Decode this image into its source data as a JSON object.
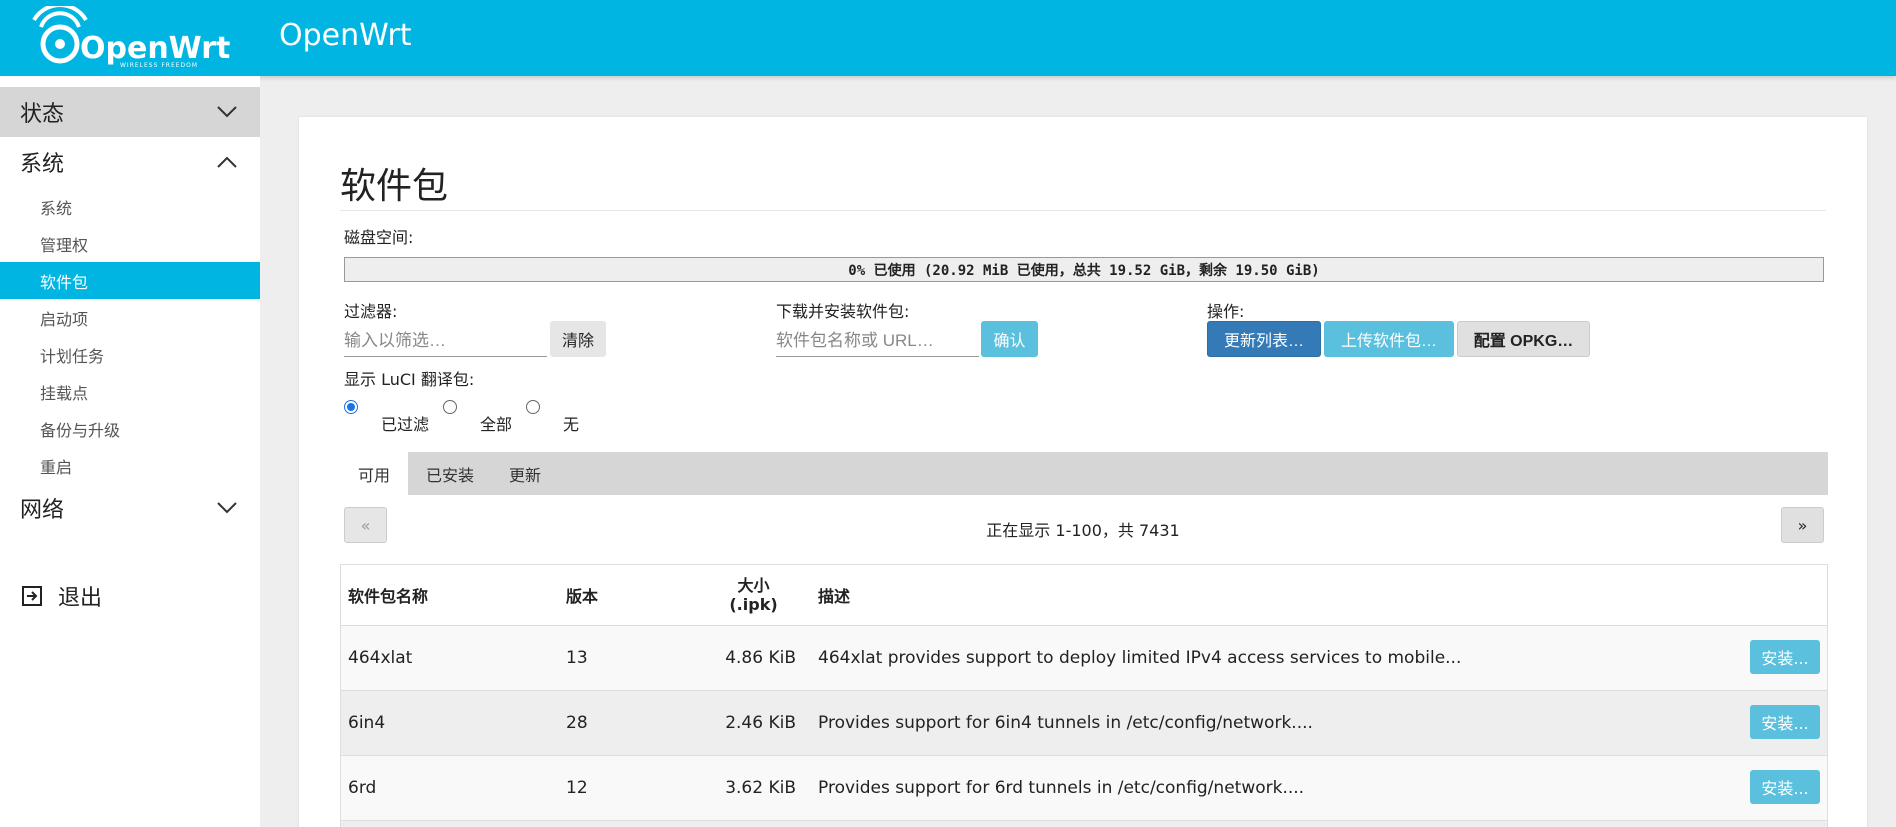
{
  "header": {
    "logo_text": "OpenWrt",
    "logo_tagline": "WIRELESS FREEDOM",
    "hostname": "OpenWrt"
  },
  "sidebar": {
    "sections": [
      {
        "label": "状态",
        "expanded": false
      },
      {
        "label": "系统",
        "expanded": true
      },
      {
        "label": "网络",
        "expanded": false
      }
    ],
    "system_items": [
      {
        "label": "系统"
      },
      {
        "label": "管理权"
      },
      {
        "label": "软件包",
        "selected": true
      },
      {
        "label": "启动项"
      },
      {
        "label": "计划任务"
      },
      {
        "label": "挂载点"
      },
      {
        "label": "备份与升级"
      },
      {
        "label": "重启"
      }
    ],
    "logout_label": "退出"
  },
  "page": {
    "title": "软件包",
    "disk_label": "磁盘空间:",
    "disk_usage_text": "0% 已使用 (20.92 MiB 已使用，总共 19.52 GiB，剩余 19.50 GiB)",
    "disk_usage_percent": 0,
    "filter": {
      "label": "过滤器:",
      "placeholder": "输入以筛选…",
      "clear_button": "清除"
    },
    "download": {
      "label": "下载并安装软件包:",
      "placeholder": "软件包名称或 URL…",
      "confirm_button": "确认"
    },
    "actions": {
      "label": "操作:",
      "update_button": "更新列表…",
      "upload_button": "上传软件包…",
      "configure_button": "配置 OPKG…"
    },
    "luci_translations": {
      "label": "显示 LuCI 翻译包:",
      "options": [
        "已过滤",
        "全部",
        "无"
      ],
      "selected": "已过滤"
    },
    "tabs": [
      {
        "label": "可用",
        "active": true
      },
      {
        "label": "已安装"
      },
      {
        "label": "更新"
      }
    ],
    "pager": {
      "prev": "«",
      "next": "»",
      "text": "正在显示 1-100，共 7431"
    },
    "table": {
      "headers": [
        "软件包名称",
        "版本",
        "大小",
        "(.ipk)",
        "描述"
      ],
      "rows": [
        {
          "name": "464xlat",
          "version": "13",
          "size": "4.86 KiB",
          "desc": "464xlat provides support to deploy limited IPv4 access services to mobile...",
          "action": "安装..."
        },
        {
          "name": "6in4",
          "version": "28",
          "size": "2.46 KiB",
          "desc": "Provides support for 6in4 tunnels in /etc/config/network....",
          "action": "安装..."
        },
        {
          "name": "6rd",
          "version": "12",
          "size": "3.62 KiB",
          "desc": "Provides support for 6rd tunnels in /etc/config/network....",
          "action": "安装..."
        }
      ]
    }
  },
  "colors": {
    "header_bg": "#00b5e2",
    "selected_item_bg": "#00b5e2",
    "install_button": "#5bc0de",
    "primary_button": "#337ab7"
  }
}
